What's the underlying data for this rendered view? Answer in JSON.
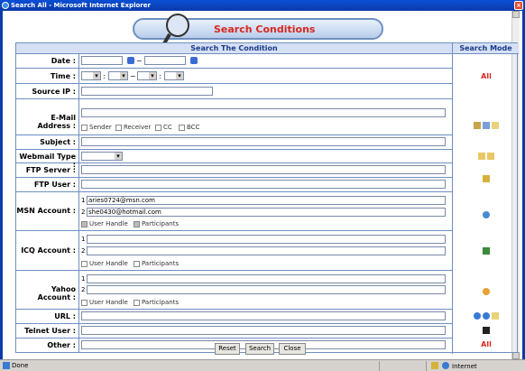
{
  "window": {
    "title": "Search All - Microsoft Internet Explorer"
  },
  "banner": {
    "title": "Search Conditions"
  },
  "header": {
    "condition": "Search The Condition",
    "mode": "Search Mode"
  },
  "rows": {
    "date": "Date :",
    "time": "Time :",
    "source_ip": "Source IP :",
    "email": "E-Mail Address :",
    "subject": "Subject :",
    "webmail": "Webmail Type :",
    "ftp_server": "FTP Server :",
    "ftp_user": "FTP User :",
    "msn": "MSN Account :",
    "icq": "ICQ Account :",
    "yahoo": "Yahoo Account :",
    "url": "URL :",
    "telnet": "Telnet User :",
    "other": "Other :"
  },
  "date": {
    "sep": "~"
  },
  "time": {
    "colon": ":",
    "sep": "~"
  },
  "email_opts": [
    "Sender",
    "Receiver",
    "CC",
    "BCC"
  ],
  "msn": {
    "n1": "1",
    "v1": "aries0724@msn.com",
    "n2": "2",
    "v2": "she0430@hotmail.com",
    "opt1": "User Handle",
    "opt2": "Participants"
  },
  "icq": {
    "n1": "1",
    "n2": "2",
    "opt1": "User Handle",
    "opt2": "Participants"
  },
  "yahoo": {
    "n1": "1",
    "n2": "2",
    "opt1": "User Handle",
    "opt2": "Participants"
  },
  "mode_all_top": "All",
  "mode_all_bottom": "All",
  "buttons": {
    "reset": "Reset",
    "search": "Search",
    "close": "Close"
  },
  "status": {
    "done": "Done",
    "zone": "Internet"
  }
}
